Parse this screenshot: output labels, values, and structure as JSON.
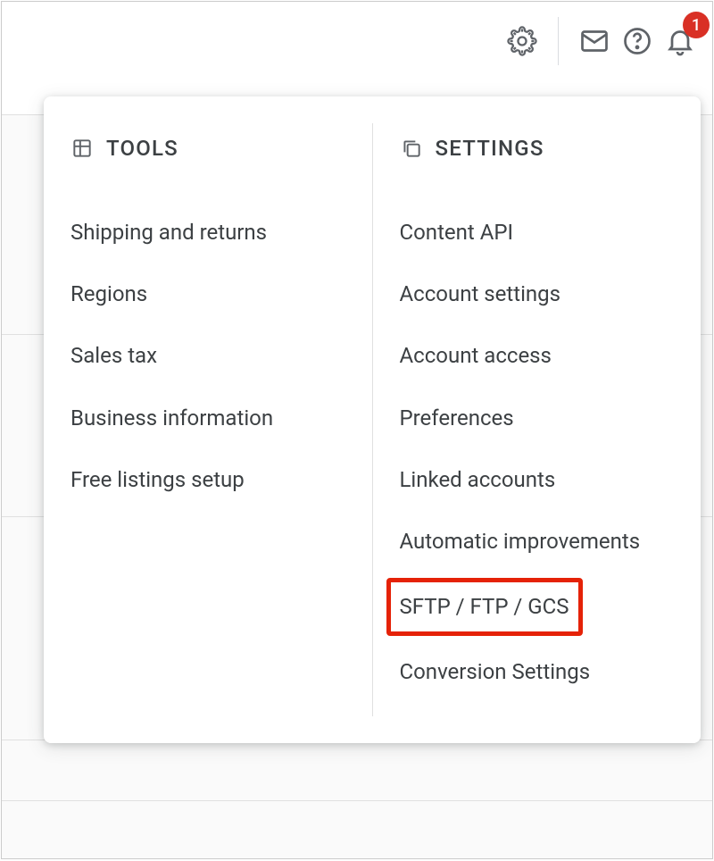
{
  "toolbar": {
    "notification_count": "1"
  },
  "menu": {
    "tools": {
      "header": "TOOLS",
      "items": [
        "Shipping and returns",
        "Regions",
        "Sales tax",
        "Business information",
        "Free listings setup"
      ]
    },
    "settings": {
      "header": "SETTINGS",
      "items": [
        "Content API",
        "Account settings",
        "Account access",
        "Preferences",
        "Linked accounts",
        "Automatic improvements",
        "SFTP / FTP / GCS",
        "Conversion Settings"
      ],
      "highlighted_index": 6
    }
  }
}
